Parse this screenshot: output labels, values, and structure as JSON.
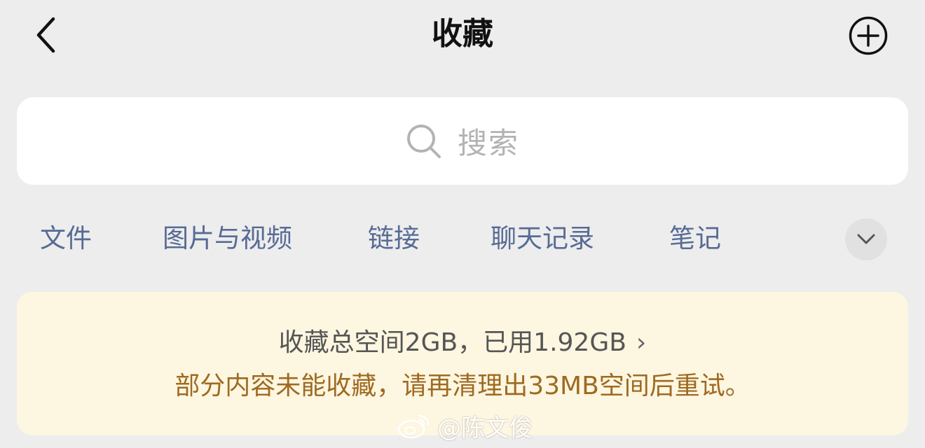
{
  "nav": {
    "title": "收藏",
    "back_icon": "chevron-left-icon",
    "add_icon": "plus-circle-icon"
  },
  "search": {
    "icon": "search-icon",
    "placeholder": "搜索"
  },
  "filters": {
    "items": [
      {
        "label": "文件"
      },
      {
        "label": "图片与视频"
      },
      {
        "label": "链接"
      },
      {
        "label": "聊天记录"
      },
      {
        "label": "笔记"
      }
    ],
    "expand_icon": "chevron-down-icon"
  },
  "storage_banner": {
    "usage_text": "收藏总空间2GB，已用1.92GB",
    "chevron": "›",
    "warning_text": "部分内容未能收藏，请再清理出33MB空间后重试。",
    "warning_color": "#9e6a22",
    "background_color": "#fdf6e0"
  },
  "watermark": {
    "icon": "weibo-logo-icon",
    "text": "@陈文俊"
  },
  "colors": {
    "background": "#ededed",
    "link_blue": "#576b95"
  }
}
